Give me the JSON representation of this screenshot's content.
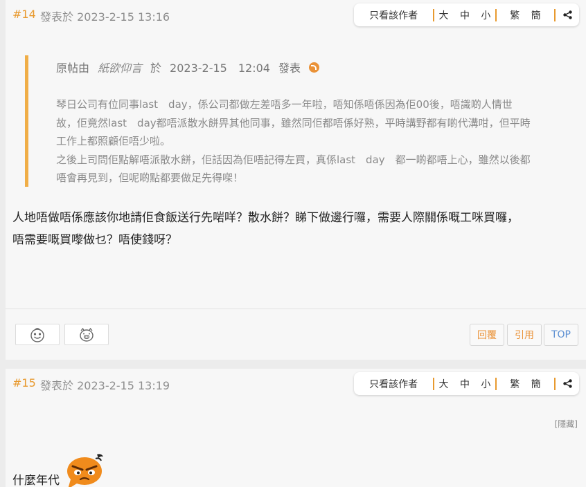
{
  "posts": [
    {
      "floor": "#14",
      "posted_label": "發表於",
      "datetime": "2023-2-15 13:16",
      "toolbar": {
        "only_author": "只看該作者",
        "size": "大 中 小",
        "convert": "繁 簡"
      },
      "quote": {
        "prefix": "原帖由",
        "author": "紙欲仰言",
        "at": "於",
        "datetime": "2023-2-15　12:04",
        "suffix": "發表",
        "lines": [
          "琴日公司有位同事last　day，係公司都做左差唔多一年啦，唔知係唔係因為佢00後，唔識啲人情世",
          "故，佢竟然last　day都唔派散水餅畀其他同事，雖然同佢都唔係好熟，平時講野都有啲代溝咁，但平時",
          "工作上都照顧佢唔少啦。",
          "之後上司問佢點解唔派散水餅，佢話因為佢唔記得左買，真係last　day　都一啲都唔上心，雖然以後都",
          "唔會再見到，但呢啲點都要做足先得㗎！"
        ]
      },
      "content_lines": [
        "人地唔做唔係應該你地請佢食飯送行先啱咩？散水餅？睇下做邊行囉，需要人際關係嘅工咪買囉，",
        "唔需要嘅買嚟做乜？唔使錢呀？"
      ],
      "actions": {
        "reply": "回覆",
        "quote": "引用",
        "top": "TOP"
      }
    },
    {
      "floor": "#15",
      "posted_label": "發表於",
      "datetime": "2023-2-15 13:19",
      "toolbar": {
        "only_author": "只看該作者",
        "size": "大 中 小",
        "convert": "繁 簡"
      },
      "hide": "[隱藏]",
      "content": "什麼年代"
    }
  ],
  "colors": {
    "accent": "#e89a2f",
    "quote_bar": "#f0ae47",
    "top_link": "#5b8fd2"
  },
  "icons": [
    "share-icon",
    "goto-post-icon",
    "smile-rate-icon",
    "pig-rate-icon",
    "angry-emoji-icon"
  ]
}
